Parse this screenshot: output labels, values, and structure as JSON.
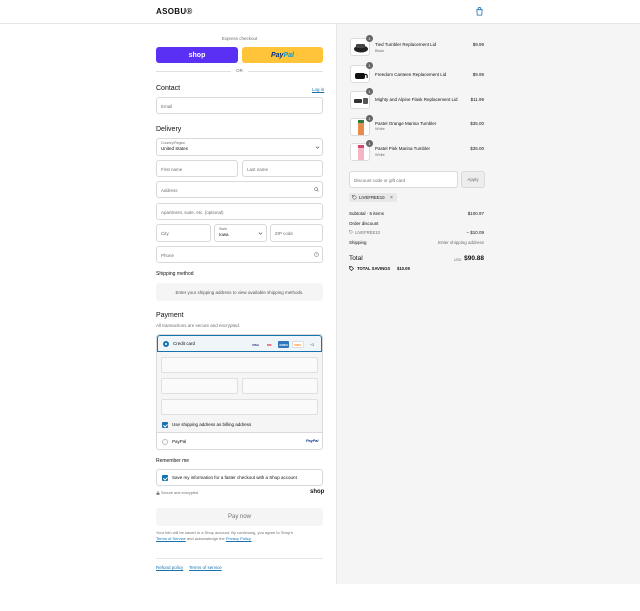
{
  "header": {
    "brand": "ASOBU®",
    "cart_icon": "shopping-bag-icon"
  },
  "express": {
    "label": "Express checkout",
    "shop_label": "shop",
    "paypal_pay": "Pay",
    "paypal_pal": "Pal",
    "or_text": "OR"
  },
  "contact": {
    "title": "Contact",
    "login_label": "Log in",
    "email_placeholder": "Email"
  },
  "delivery": {
    "title": "Delivery",
    "country_label": "Country/Region",
    "country_value": "United States",
    "first_name_placeholder": "First name",
    "last_name_placeholder": "Last name",
    "address_placeholder": "Address",
    "apartment_placeholder": "Apartment, suite, etc. (optional)",
    "city_placeholder": "City",
    "state_label": "State",
    "state_value": "Iowa",
    "zip_placeholder": "ZIP code",
    "phone_placeholder": "Phone"
  },
  "shipping_method": {
    "title": "Shipping method",
    "message": "Enter your shipping address to view available shipping methods."
  },
  "payment": {
    "title": "Payment",
    "subtitle": "All transactions are secure and encrypted.",
    "credit_card_label": "Credit card",
    "card_brands": [
      "VISA",
      "MC",
      "AMEX",
      "DISC"
    ],
    "more_cards": "+3",
    "billing_label": "Use shipping address as billing address",
    "paypal_label": "PayPal",
    "paypal_logo": "PayPal"
  },
  "remember": {
    "title": "Remember me",
    "checkbox_label": "Save my information for a faster checkout with a Shop account",
    "secure_label": "Secure and encrypted",
    "shop_logo": "shop"
  },
  "pay_now_label": "Pay now",
  "legal": {
    "line1": "Your info will be saved to a Shop account. By continuing, you agree to Shop's",
    "tos": "Terms of Service",
    "and_ack": "and acknowledge the",
    "privacy": "Privacy Policy."
  },
  "footer": {
    "refund": "Refund policy",
    "terms": "Terms of service"
  },
  "order": {
    "items": [
      {
        "name": "Tied Tumbler Replacement Lid",
        "variant": "Black",
        "price": "$9.99",
        "qty": "1"
      },
      {
        "name": "Freedom Canteen Replacement Lid",
        "variant": "",
        "price": "$9.99",
        "qty": "1"
      },
      {
        "name": "Mighty and Alpine Flask Replacement Lid",
        "variant": "",
        "price": "$11.99",
        "qty": "1"
      },
      {
        "name": "Pastel Orange Marina Tumbler",
        "variant": "White",
        "price": "$35.00",
        "qty": "1"
      },
      {
        "name": "Pastel Pink Marina Tumbler",
        "variant": "White",
        "price": "$35.00",
        "qty": "1"
      }
    ],
    "discount_placeholder": "Discount code or gift card",
    "apply_label": "Apply",
    "applied_code": "LIVEFREE10",
    "subtotal_label": "Subtotal · 5 items",
    "subtotal_value": "$100.97",
    "order_discount_label": "Order discount",
    "discount_code": "LIVEFREE10",
    "discount_value": "– $10.09",
    "shipping_label": "Shipping",
    "shipping_value": "Enter shipping address",
    "total_label": "Total",
    "currency": "USD",
    "total_value": "$90.88",
    "savings_label": "TOTAL SAVINGS",
    "savings_value": "$10.09"
  }
}
